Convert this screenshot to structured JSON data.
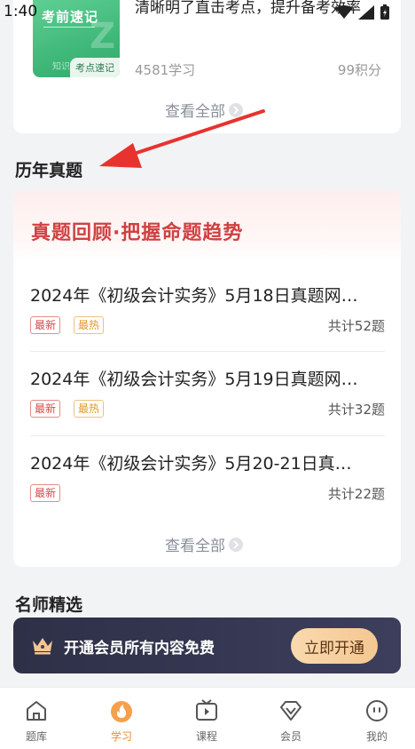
{
  "status": {
    "time": "1:40"
  },
  "top_card": {
    "cover_title": "考前速记",
    "cover_tag": "考点速记",
    "cover_small": "知识",
    "description": "清晰明了直击考点，提升备考效率",
    "learners": "4581学习",
    "points": "99积分",
    "view_all": "查看全部"
  },
  "past_exams": {
    "section_title": "历年真题",
    "banner_title": "真题回顾·把握命题趋势",
    "items": [
      {
        "title": "2024年《初级会计实务》5月18日真题网…",
        "tags": [
          "最新",
          "最热"
        ],
        "count": "共计52题"
      },
      {
        "title": "2024年《初级会计实务》5月19日真题网…",
        "tags": [
          "最新",
          "最热"
        ],
        "count": "共计32题"
      },
      {
        "title": "2024年《初级会计实务》5月20-21日真…",
        "tags": [
          "最新"
        ],
        "count": "共计22题"
      }
    ],
    "view_all": "查看全部"
  },
  "teachers": {
    "section_title": "名师精选"
  },
  "promo": {
    "text": "开通会员所有内容免费",
    "button": "立即开通"
  },
  "tabbar": {
    "items": [
      {
        "label": "题库",
        "icon": "home-icon"
      },
      {
        "label": "学习",
        "icon": "flame-icon",
        "active": true
      },
      {
        "label": "课程",
        "icon": "tv-play-icon"
      },
      {
        "label": "会员",
        "icon": "diamond-icon"
      },
      {
        "label": "我的",
        "icon": "face-icon"
      }
    ]
  },
  "colors": {
    "accent_orange": "#f28a2e",
    "banner_red": "#cf4141",
    "promo_dark": "#2e3048",
    "promo_gold": "#f4c791",
    "cover_green": "#3fb878"
  }
}
